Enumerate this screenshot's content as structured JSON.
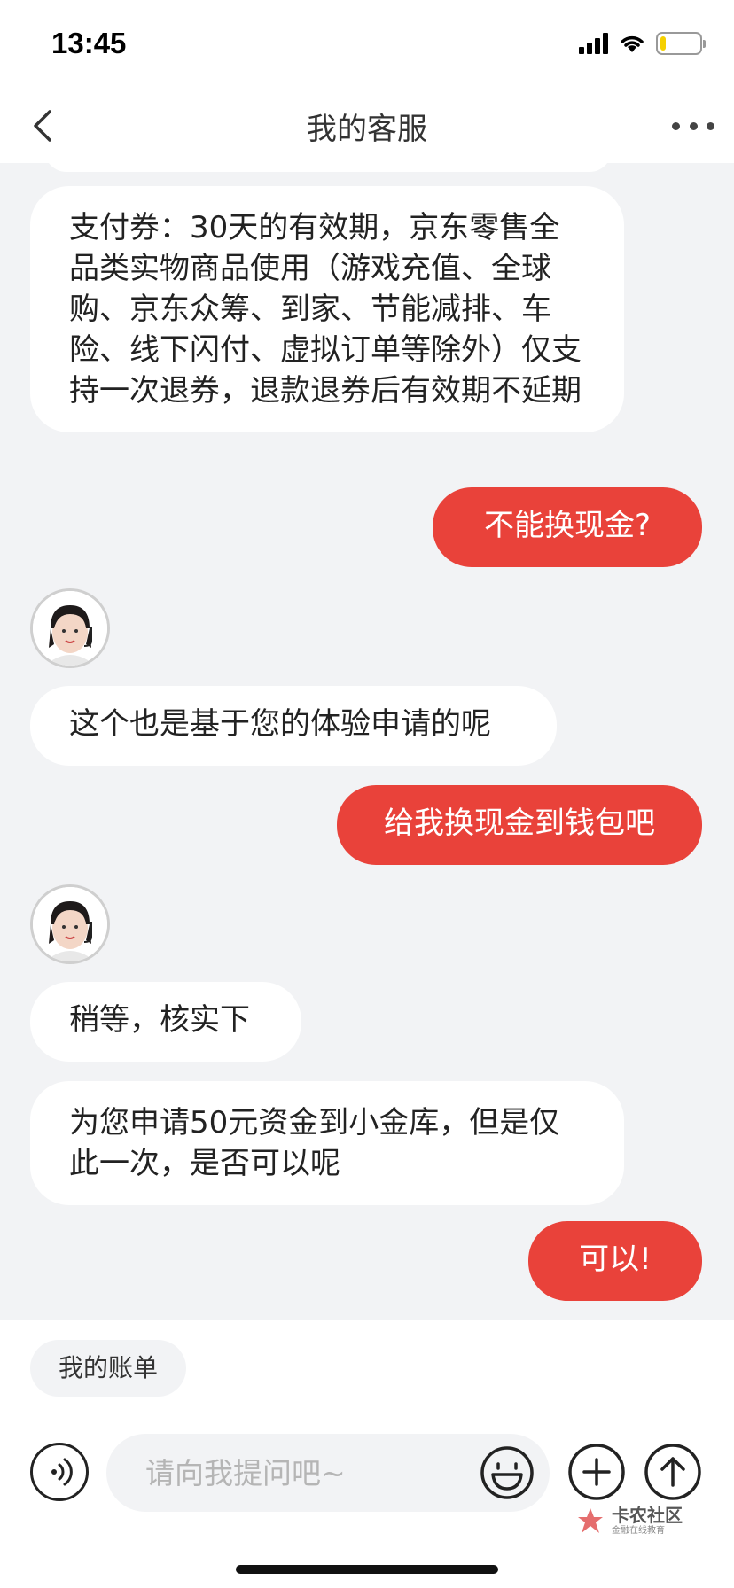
{
  "status_bar": {
    "time": "13:45",
    "battery_level": 0.15
  },
  "nav": {
    "title": "我的客服"
  },
  "messages": [
    {
      "from": "agent",
      "text": "支付券：30天的有效期，京东零售全品类实物商品使用（游戏充值、全球购、京东众筹、到家、节能减排、车险、线下闪付、虚拟订单等除外）仅支持一次退券，退款退券后有效期不延期"
    },
    {
      "from": "user",
      "text": "不能换现金?"
    },
    {
      "from": "agent",
      "text": "这个也是基于您的体验申请的呢"
    },
    {
      "from": "user",
      "text": "给我换现金到钱包吧"
    },
    {
      "from": "agent",
      "text": "稍等，核实下"
    },
    {
      "from": "agent",
      "text": "为您申请50元资金到小金库，但是仅此一次，是否可以呢"
    },
    {
      "from": "user",
      "text": "可以!"
    }
  ],
  "quick_actions": [
    {
      "label": "我的账单"
    }
  ],
  "composer": {
    "placeholder": "请向我提问吧~"
  },
  "watermark": {
    "name": "卡农社区",
    "tagline": "金融在线教育"
  },
  "colors": {
    "accent": "#e9423a",
    "background": "#f2f3f5"
  }
}
